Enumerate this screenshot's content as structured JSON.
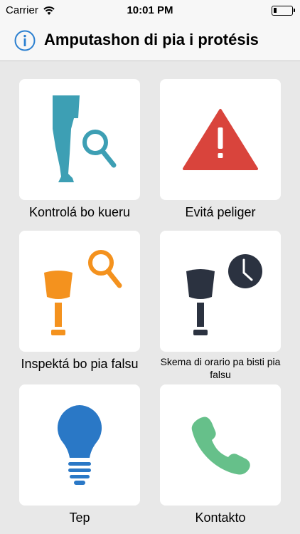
{
  "status": {
    "carrier": "Carrier",
    "time": "10:01 PM"
  },
  "nav": {
    "title": "Amputashon di pia i protésis",
    "info_icon": "info-icon"
  },
  "tiles": [
    {
      "label": "Kontrolá bo kueru",
      "icon": "leg-magnifier-icon"
    },
    {
      "label": "Evitá peliger",
      "icon": "warning-icon"
    },
    {
      "label": "Inspektá bo pia falsu",
      "icon": "prosthesis-magnifier-icon"
    },
    {
      "label": "Skema di orario pa bisti pia falsu",
      "icon": "prosthesis-clock-icon"
    },
    {
      "label": "Tep",
      "icon": "lightbulb-icon"
    },
    {
      "label": "Kontakto",
      "icon": "phone-icon"
    }
  ],
  "colors": {
    "teal": "#3d9fb4",
    "red": "#d9443c",
    "orange": "#f4921e",
    "navy": "#2b3240",
    "blue": "#2a78c6",
    "green": "#66c08a",
    "nav_blue": "#2a7fd0"
  }
}
